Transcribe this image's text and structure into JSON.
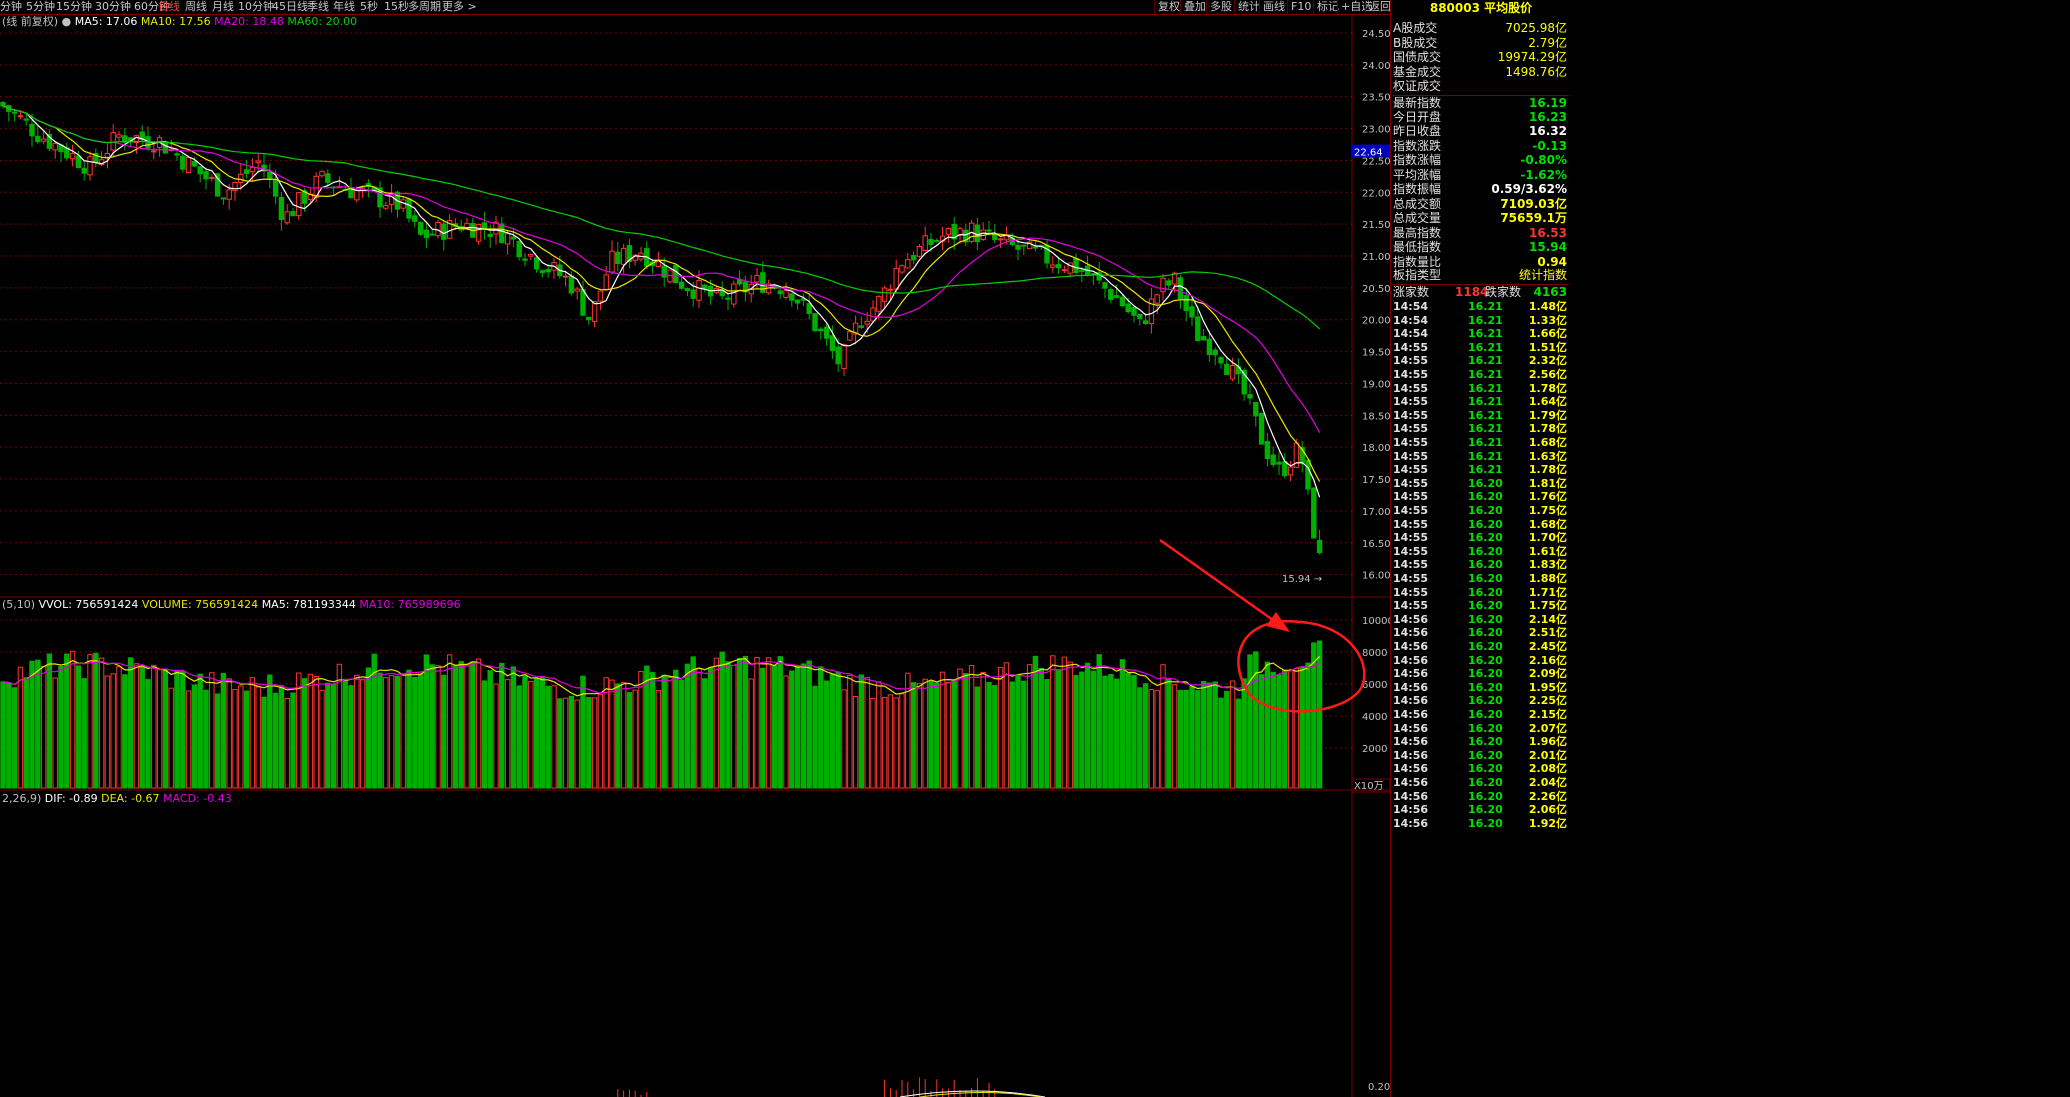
{
  "toolbar": {
    "periods": [
      "分钟",
      "5分钟",
      "15分钟",
      "30分钟",
      "60分钟",
      "日线",
      "周线",
      "月线",
      "10分钟",
      "45日线",
      "季线",
      "年线",
      "5秒",
      "15秒",
      "多周期",
      "更多 >"
    ],
    "active_period": "日线",
    "right_buttons": [
      "复权",
      "叠加",
      "多股",
      "统计",
      "画线",
      "F10",
      "标记",
      "+自选",
      "返回"
    ]
  },
  "ma_legend": {
    "prefix": "线 前复权",
    "ma5": "MA5: 17.06",
    "ma10": "MA10: 17.56",
    "ma20": "MA20: 18.48",
    "ma60": "MA60: 20.00"
  },
  "vol_legend": {
    "prefix": "(5,10)",
    "vvol": "VVOL: 756591424",
    "volume": "VOLUME: 756591424",
    "ma5": "MA5: 781193344",
    "ma10": "MA10: 765989696"
  },
  "macd_legend": {
    "prefix": "2,26,9)",
    "dif": "DIF: -0.89",
    "dea": "DEA: -0.67",
    "macd": "MACD: -0.43"
  },
  "price_axis": [
    "24.50",
    "24.00",
    "23.50",
    "23.00",
    "22.50",
    "22.00",
    "21.50",
    "21.00",
    "20.50",
    "20.00",
    "19.50",
    "19.00",
    "18.50",
    "18.00",
    "17.50",
    "17.00",
    "16.50",
    "16.00"
  ],
  "price_marker": "22.64",
  "low_label": "15.94",
  "vol_axis": [
    "10000",
    "8000",
    "6000",
    "4000",
    "2000"
  ],
  "vol_unit": "X10万",
  "macd_axis": [
    "0.20"
  ],
  "colors": {
    "up": "#ff3232",
    "down": "#00b000",
    "ma5": "#ffffff",
    "ma10": "#e8e800",
    "ma20": "#e000e0",
    "ma60": "#00d000",
    "grid": "#7a0000",
    "annotation": "#ff1a1a"
  },
  "index_panel": {
    "code": "880003",
    "name": "平均股价",
    "market": [
      {
        "k": "A股成交",
        "v": "7025.98亿"
      },
      {
        "k": "B股成交",
        "v": "2.79亿"
      },
      {
        "k": "国债成交",
        "v": "19974.29亿"
      },
      {
        "k": "基金成交",
        "v": "1498.76亿"
      },
      {
        "k": "权证成交",
        "v": ""
      }
    ],
    "stats": [
      {
        "k": "最新指数",
        "v": "16.19",
        "c": "#00e000"
      },
      {
        "k": "今日开盘",
        "v": "16.23",
        "c": "#00e000"
      },
      {
        "k": "昨日收盘",
        "v": "16.32",
        "c": "#ffffff"
      },
      {
        "k": "指数涨跌",
        "v": "-0.13",
        "c": "#00e000"
      },
      {
        "k": "指数涨幅",
        "v": "-0.80%",
        "c": "#00e000"
      },
      {
        "k": "平均涨幅",
        "v": "-1.62%",
        "c": "#00e000"
      },
      {
        "k": "指数振幅",
        "v": "0.59/3.62%",
        "c": "#ffffff"
      },
      {
        "k": "总成交额",
        "v": "7109.03亿",
        "c": "#ffff00"
      },
      {
        "k": "总成交量",
        "v": "75659.1万",
        "c": "#ffff00"
      },
      {
        "k": "最高指数",
        "v": "16.53",
        "c": "#ff3232"
      },
      {
        "k": "最低指数",
        "v": "15.94",
        "c": "#00e000"
      },
      {
        "k": "指数量比",
        "v": "0.94",
        "c": "#ffff00"
      }
    ],
    "board_type_label": "板指类型",
    "board_type_value": "统计指数",
    "up_label": "涨家数",
    "up_count": "1184",
    "down_label": "跌家数",
    "down_count": "4163",
    "ticks": [
      {
        "t": "14:54",
        "p": "16.21",
        "a": "1.48亿"
      },
      {
        "t": "14:54",
        "p": "16.21",
        "a": "1.33亿"
      },
      {
        "t": "14:54",
        "p": "16.21",
        "a": "1.66亿"
      },
      {
        "t": "14:55",
        "p": "16.21",
        "a": "1.51亿"
      },
      {
        "t": "14:55",
        "p": "16.21",
        "a": "2.32亿"
      },
      {
        "t": "14:55",
        "p": "16.21",
        "a": "2.56亿"
      },
      {
        "t": "14:55",
        "p": "16.21",
        "a": "1.78亿"
      },
      {
        "t": "14:55",
        "p": "16.21",
        "a": "1.64亿"
      },
      {
        "t": "14:55",
        "p": "16.21",
        "a": "1.79亿"
      },
      {
        "t": "14:55",
        "p": "16.21",
        "a": "1.78亿"
      },
      {
        "t": "14:55",
        "p": "16.21",
        "a": "1.68亿"
      },
      {
        "t": "14:55",
        "p": "16.21",
        "a": "1.63亿"
      },
      {
        "t": "14:55",
        "p": "16.21",
        "a": "1.78亿"
      },
      {
        "t": "14:55",
        "p": "16.20",
        "a": "1.81亿"
      },
      {
        "t": "14:55",
        "p": "16.20",
        "a": "1.76亿"
      },
      {
        "t": "14:55",
        "p": "16.20",
        "a": "1.75亿"
      },
      {
        "t": "14:55",
        "p": "16.20",
        "a": "1.68亿"
      },
      {
        "t": "14:55",
        "p": "16.20",
        "a": "1.70亿"
      },
      {
        "t": "14:55",
        "p": "16.20",
        "a": "1.61亿"
      },
      {
        "t": "14:55",
        "p": "16.20",
        "a": "1.83亿"
      },
      {
        "t": "14:55",
        "p": "16.20",
        "a": "1.88亿"
      },
      {
        "t": "14:55",
        "p": "16.20",
        "a": "1.71亿"
      },
      {
        "t": "14:55",
        "p": "16.20",
        "a": "1.75亿"
      },
      {
        "t": "14:56",
        "p": "16.20",
        "a": "2.14亿"
      },
      {
        "t": "14:56",
        "p": "16.20",
        "a": "2.51亿"
      },
      {
        "t": "14:56",
        "p": "16.20",
        "a": "2.45亿"
      },
      {
        "t": "14:56",
        "p": "16.20",
        "a": "2.16亿"
      },
      {
        "t": "14:56",
        "p": "16.20",
        "a": "2.09亿"
      },
      {
        "t": "14:56",
        "p": "16.20",
        "a": "1.95亿"
      },
      {
        "t": "14:56",
        "p": "16.20",
        "a": "2.25亿"
      },
      {
        "t": "14:56",
        "p": "16.20",
        "a": "2.15亿"
      },
      {
        "t": "14:56",
        "p": "16.20",
        "a": "2.07亿"
      },
      {
        "t": "14:56",
        "p": "16.20",
        "a": "1.96亿"
      },
      {
        "t": "14:56",
        "p": "16.20",
        "a": "2.01亿"
      },
      {
        "t": "14:56",
        "p": "16.20",
        "a": "2.08亿"
      },
      {
        "t": "14:56",
        "p": "16.20",
        "a": "2.04亿"
      },
      {
        "t": "14:56",
        "p": "16.20",
        "a": "2.26亿"
      },
      {
        "t": "14:56",
        "p": "16.20",
        "a": "2.06亿"
      },
      {
        "t": "14:56",
        "p": "16.20",
        "a": "1.92亿"
      }
    ]
  }
}
